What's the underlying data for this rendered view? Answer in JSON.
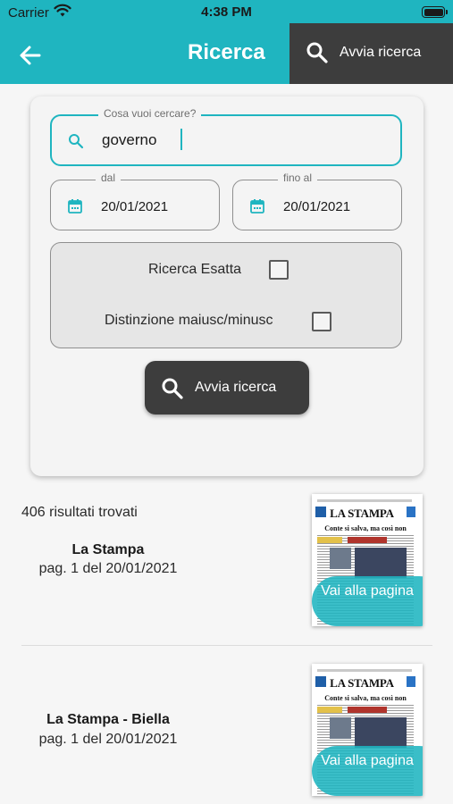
{
  "status_bar": {
    "carrier": "Carrier",
    "time": "4:38 PM"
  },
  "app_bar": {
    "title": "Ricerca",
    "action_label": "Avvia ricerca"
  },
  "search_form": {
    "query_label": "Cosa vuoi cercare?",
    "query_value": "governo",
    "from_label": "dal",
    "from_value": "20/01/2021",
    "to_label": "fino al",
    "to_value": "20/01/2021",
    "options": [
      {
        "label": "Ricerca Esatta",
        "checked": false
      },
      {
        "label": "Distinzione maiusc/minusc",
        "checked": false
      }
    ],
    "submit_label": "Avvia ricerca"
  },
  "results": {
    "count_text": "406 risultati trovati",
    "items": [
      {
        "title": "La Stampa",
        "subtitle": "pag. 1 del 20/01/2021",
        "thumb_masthead": "LA STAMPA",
        "thumb_headline": "Conte si salva, ma così non governa",
        "thumb_button": "Vai alla pagina"
      },
      {
        "title": "La Stampa - Biella",
        "subtitle": "pag. 1 del 20/01/2021",
        "thumb_masthead": "LA STAMPA",
        "thumb_headline": "Conte si salva, ma così non governa",
        "thumb_button": "Vai alla pagina"
      }
    ]
  },
  "colors": {
    "primary": "#1fb5c0",
    "dark": "#3d3d3d",
    "background": "#f6f6f6"
  }
}
